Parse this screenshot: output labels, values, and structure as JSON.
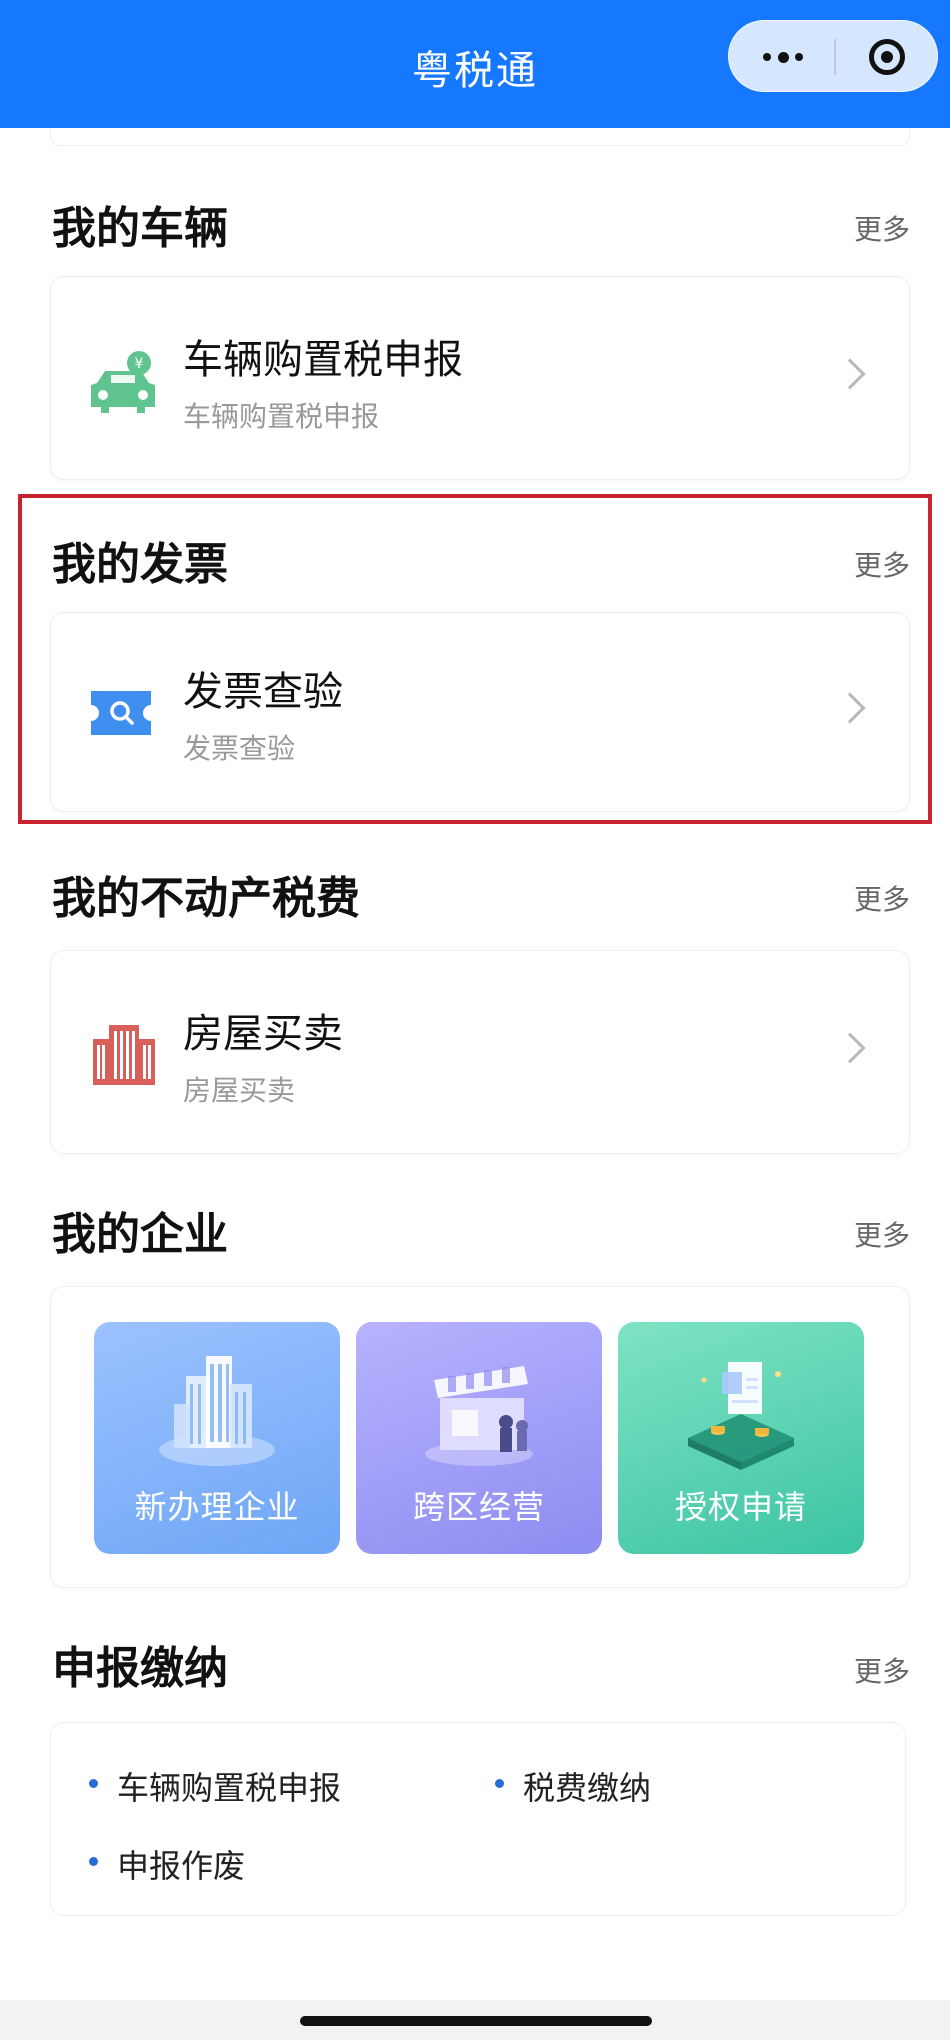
{
  "header": {
    "title": "粤税通"
  },
  "sections": {
    "vehicles": {
      "title": "我的车辆",
      "more": "更多",
      "item": {
        "title": "车辆购置税申报",
        "subtitle": "车辆购置税申报"
      }
    },
    "invoices": {
      "title": "我的发票",
      "more": "更多",
      "item": {
        "title": "发票查验",
        "subtitle": "发票查验"
      }
    },
    "property": {
      "title": "我的不动产税费",
      "more": "更多",
      "item": {
        "title": "房屋买卖",
        "subtitle": "房屋买卖"
      }
    },
    "enterprise": {
      "title": "我的企业",
      "more": "更多",
      "tiles": [
        {
          "label": "新办理企业"
        },
        {
          "label": "跨区经营"
        },
        {
          "label": "授权申请"
        }
      ]
    },
    "declare": {
      "title": "申报缴纳",
      "more": "更多",
      "links": [
        "车辆购置税申报",
        "税费缴纳",
        "申报作废"
      ]
    }
  },
  "colors": {
    "topbar": "#1677ff",
    "highlight_border": "#c9232e",
    "car_icon": "#5fc48f",
    "invoice_icon": "#3f8ff0",
    "building_icon": "#d9605a",
    "bullet": "#2b6bd6"
  },
  "icons": {
    "vehicle": "car-yuan-icon",
    "invoice": "invoice-search-icon",
    "property": "building-icon"
  }
}
